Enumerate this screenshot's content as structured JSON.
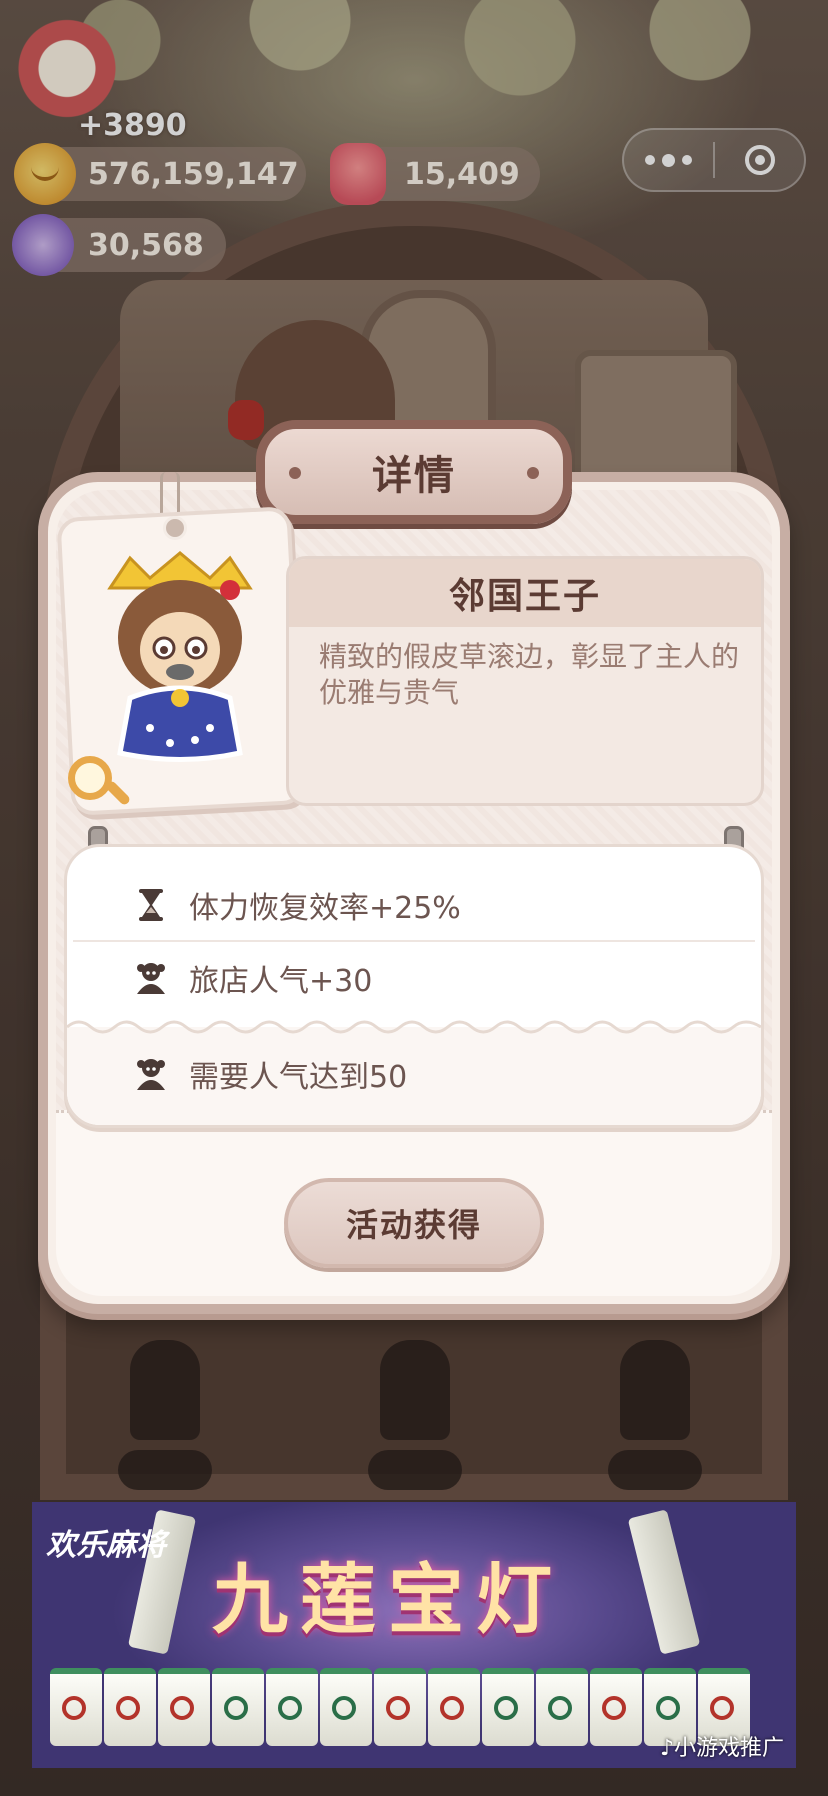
{
  "currency": {
    "gain": "+3890",
    "coins": "576,159,147",
    "gems": "15,409",
    "fish": "30,568"
  },
  "dialog": {
    "title": "详情",
    "item_name": "邻国王子",
    "item_desc": "精致的假皮草滚边，彰显了主人的优雅与贵气",
    "stats": [
      {
        "icon": "hourglass-icon",
        "text": "体力恢复效率+25%"
      },
      {
        "icon": "popularity-icon",
        "text": "旅店人气+30"
      }
    ],
    "requirement": {
      "icon": "popularity-icon",
      "text": "需要人气达到50"
    },
    "button_label": "活动获得"
  },
  "ad": {
    "logo": "欢乐麻将",
    "title": "九莲宝灯",
    "tag": "♪小游戏推广"
  },
  "colors": {
    "dialog_bg": "#f7efe9",
    "title_border": "#8c6257",
    "text_dark": "#5b3b33",
    "text_muted": "#9a7c72"
  }
}
